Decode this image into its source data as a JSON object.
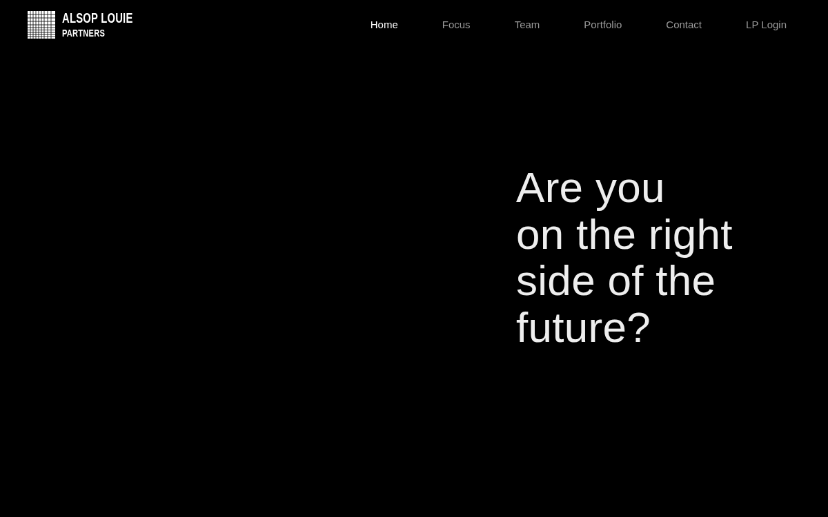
{
  "logo": {
    "line_1": "ALSOP LOUIE",
    "line_2": "PARTNERS"
  },
  "nav": [
    {
      "label": "Home",
      "selected": true
    },
    {
      "label": "Focus",
      "selected": false
    },
    {
      "label": "Team",
      "selected": false
    },
    {
      "label": "Portfolio",
      "selected": false
    },
    {
      "label": "Contact",
      "selected": false
    },
    {
      "label": "LP Login",
      "selected": false
    }
  ],
  "hero": {
    "headline_lines": [
      "Are you",
      "on the right",
      "side of the",
      "future?"
    ]
  }
}
